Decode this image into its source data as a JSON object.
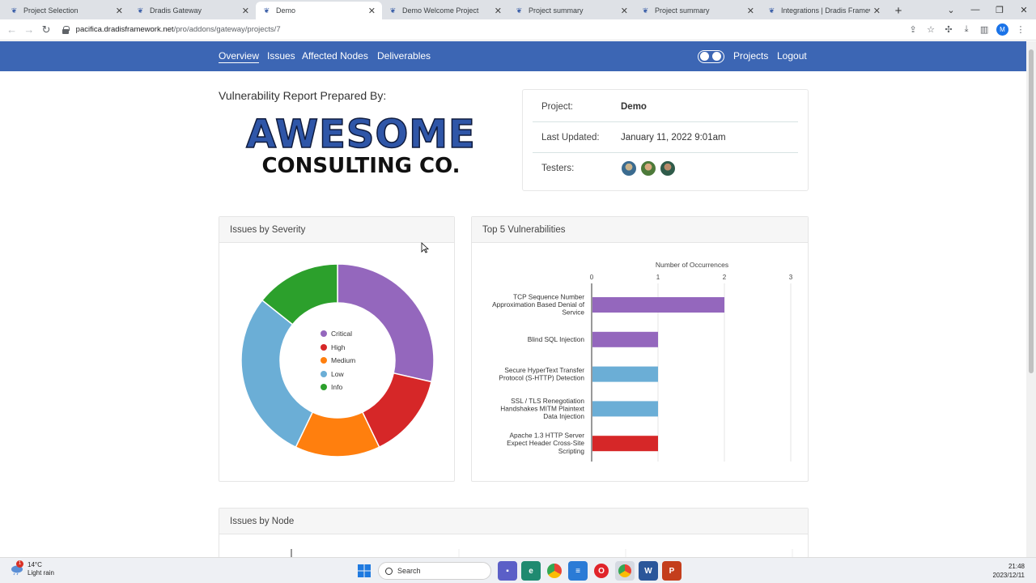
{
  "browser": {
    "tabs": [
      {
        "title": "Project Selection",
        "active": false
      },
      {
        "title": "Dradis Gateway",
        "active": false
      },
      {
        "title": "Demo",
        "active": true
      },
      {
        "title": "Demo Welcome Project",
        "active": false
      },
      {
        "title": "Project summary",
        "active": false
      },
      {
        "title": "Project summary",
        "active": false
      },
      {
        "title": "Integrations | Dradis Framewo",
        "active": false
      }
    ],
    "url_host": "pacifica.dradisframework.net",
    "url_path": "/pro/addons/gateway/projects/7",
    "profile_initial": "M"
  },
  "nav": {
    "overview": "Overview",
    "issues": "Issues",
    "affected_nodes": "Affected Nodes",
    "deliverables": "Deliverables",
    "projects": "Projects",
    "logout": "Logout"
  },
  "report": {
    "prepared_by": "Vulnerability Report Prepared By:",
    "logo_line1": "AWESOME",
    "logo_line2": "CONSULTING CO."
  },
  "project": {
    "project_label": "Project:",
    "project_value": "Demo",
    "updated_label": "Last Updated:",
    "updated_value": "January 11, 2022 9:01am",
    "testers_label": "Testers:"
  },
  "panels": {
    "severity_title": "Issues by Severity",
    "top5_title": "Top 5 Vulnerabilities",
    "node_title": "Issues by Node"
  },
  "chart_data": [
    {
      "type": "pie",
      "labels": [
        "Critical",
        "High",
        "Medium",
        "Low",
        "Info"
      ],
      "values": [
        3,
        1.5,
        1.5,
        3,
        1.5
      ],
      "colors": [
        "#9467bd",
        "#d62728",
        "#ff7f0e",
        "#6baed6",
        "#2ca02c"
      ],
      "donut": true,
      "legend": "center"
    },
    {
      "type": "bar",
      "orientation": "horizontal",
      "title": "Number of Occurrences",
      "categories": [
        [
          "TCP Sequence Number",
          "Approximation Based Denial of",
          "Service"
        ],
        [
          "Blind SQL Injection"
        ],
        [
          "Secure HyperText Transfer",
          "Protocol (S-HTTP) Detection"
        ],
        [
          "SSL / TLS Renegotiation",
          "Handshakes MITM Plaintext",
          "Data Injection"
        ],
        [
          "Apache 1.3 HTTP Server",
          "Expect Header Cross-Site",
          "Scripting"
        ]
      ],
      "values": [
        2,
        1,
        1,
        1,
        1
      ],
      "bar_colors": [
        "#9467bd",
        "#9467bd",
        "#6baed6",
        "#6baed6",
        "#d62728"
      ],
      "xlim": [
        0,
        3
      ],
      "xticks": [
        "0",
        "1",
        "2",
        "3"
      ]
    }
  ],
  "taskbar": {
    "temp": "14°C",
    "weather": "Light rain",
    "badge": "1",
    "search": "Search",
    "time": "21:48",
    "date": "2023/12/11"
  }
}
